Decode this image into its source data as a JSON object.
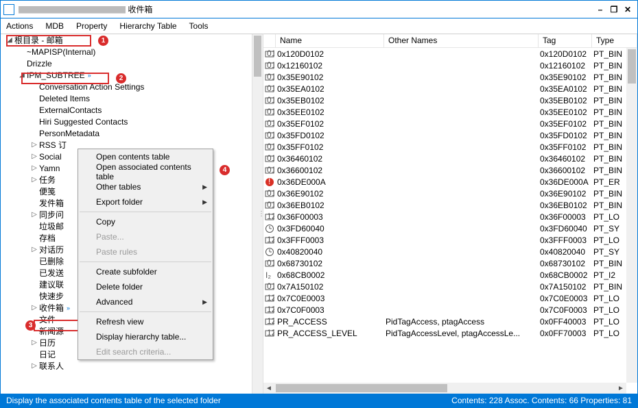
{
  "window": {
    "title_tail": "收件箱"
  },
  "menu": {
    "actions": "Actions",
    "mdb": "MDB",
    "property": "Property",
    "hierarchy": "Hierarchy Table",
    "tools": "Tools"
  },
  "tree": {
    "root": "根目录 - 邮箱",
    "items": [
      "~MAPISP(Internal)",
      "Drizzle",
      "IPM_SUBTREE",
      "Conversation Action Settings",
      "Deleted Items",
      "ExternalContacts",
      "Hiri Suggested Contacts",
      "PersonMetadata",
      "RSS 订",
      "Social",
      "Yamn",
      "任务",
      "便笺",
      "发件箱",
      "同步问",
      "垃圾邮",
      "存档",
      "对话历",
      "已删除",
      "已发送",
      "建议联",
      "快速步",
      "收件箱",
      "文件",
      "新闻源",
      "日历",
      "日记",
      "联系人"
    ]
  },
  "ctx": {
    "open_contents": "Open contents table",
    "open_assoc": "Open associated contents table",
    "other_tables": "Other tables",
    "export": "Export folder",
    "copy": "Copy",
    "paste": "Paste...",
    "paste_rules": "Paste rules",
    "create_sub": "Create subfolder",
    "delete": "Delete folder",
    "advanced": "Advanced",
    "refresh": "Refresh view",
    "disp_hier": "Display hierarchy table...",
    "edit_search": "Edit search criteria..."
  },
  "grid": {
    "head": {
      "name": "Name",
      "other": "Other Names",
      "tag": "Tag",
      "type": "Type"
    },
    "rows": [
      {
        "i": "bin",
        "n": "0x120D0102",
        "o": "",
        "t": "0x120D0102",
        "ty": "PT_BIN"
      },
      {
        "i": "bin",
        "n": "0x12160102",
        "o": "",
        "t": "0x12160102",
        "ty": "PT_BIN"
      },
      {
        "i": "bin",
        "n": "0x35E90102",
        "o": "",
        "t": "0x35E90102",
        "ty": "PT_BIN"
      },
      {
        "i": "bin",
        "n": "0x35EA0102",
        "o": "",
        "t": "0x35EA0102",
        "ty": "PT_BIN"
      },
      {
        "i": "bin",
        "n": "0x35EB0102",
        "o": "",
        "t": "0x35EB0102",
        "ty": "PT_BIN"
      },
      {
        "i": "bin",
        "n": "0x35EE0102",
        "o": "",
        "t": "0x35EE0102",
        "ty": "PT_BIN"
      },
      {
        "i": "bin",
        "n": "0x35EF0102",
        "o": "",
        "t": "0x35EF0102",
        "ty": "PT_BIN"
      },
      {
        "i": "bin",
        "n": "0x35FD0102",
        "o": "",
        "t": "0x35FD0102",
        "ty": "PT_BIN"
      },
      {
        "i": "bin",
        "n": "0x35FF0102",
        "o": "",
        "t": "0x35FF0102",
        "ty": "PT_BIN"
      },
      {
        "i": "bin",
        "n": "0x36460102",
        "o": "",
        "t": "0x36460102",
        "ty": "PT_BIN"
      },
      {
        "i": "bin",
        "n": "0x36600102",
        "o": "",
        "t": "0x36600102",
        "ty": "PT_BIN"
      },
      {
        "i": "err",
        "n": "0x36DE000A",
        "o": "",
        "t": "0x36DE000A",
        "ty": "PT_ER"
      },
      {
        "i": "bin",
        "n": "0x36E90102",
        "o": "",
        "t": "0x36E90102",
        "ty": "PT_BIN"
      },
      {
        "i": "bin",
        "n": "0x36EB0102",
        "o": "",
        "t": "0x36EB0102",
        "ty": "PT_BIN"
      },
      {
        "i": "long",
        "n": "0x36F00003",
        "o": "",
        "t": "0x36F00003",
        "ty": "PT_LO"
      },
      {
        "i": "sys",
        "n": "0x3FD60040",
        "o": "",
        "t": "0x3FD60040",
        "ty": "PT_SY"
      },
      {
        "i": "long",
        "n": "0x3FFF0003",
        "o": "",
        "t": "0x3FFF0003",
        "ty": "PT_LO"
      },
      {
        "i": "sys",
        "n": "0x40820040",
        "o": "",
        "t": "0x40820040",
        "ty": "PT_SY"
      },
      {
        "i": "bin",
        "n": "0x68730102",
        "o": "",
        "t": "0x68730102",
        "ty": "PT_BIN"
      },
      {
        "i": "i2",
        "n": "0x68CB0002",
        "o": "",
        "t": "0x68CB0002",
        "ty": "PT_I2"
      },
      {
        "i": "bin",
        "n": "0x7A150102",
        "o": "",
        "t": "0x7A150102",
        "ty": "PT_BIN"
      },
      {
        "i": "long",
        "n": "0x7C0E0003",
        "o": "",
        "t": "0x7C0E0003",
        "ty": "PT_LO"
      },
      {
        "i": "long",
        "n": "0x7C0F0003",
        "o": "",
        "t": "0x7C0F0003",
        "ty": "PT_LO"
      },
      {
        "i": "long",
        "n": "PR_ACCESS",
        "o": "PidTagAccess, ptagAccess",
        "t": "0x0FF40003",
        "ty": "PT_LO"
      },
      {
        "i": "long",
        "n": "PR_ACCESS_LEVEL",
        "o": "PidTagAccessLevel, ptagAccessLe...",
        "t": "0x0FF70003",
        "ty": "PT_LO"
      }
    ]
  },
  "status": {
    "left": "Display the associated contents table of the selected folder",
    "right": "Contents: 228 Assoc. Contents: 66   Properties: 81"
  },
  "annot": {
    "a1": "1",
    "a2": "2",
    "a3": "3",
    "a4": "4"
  }
}
